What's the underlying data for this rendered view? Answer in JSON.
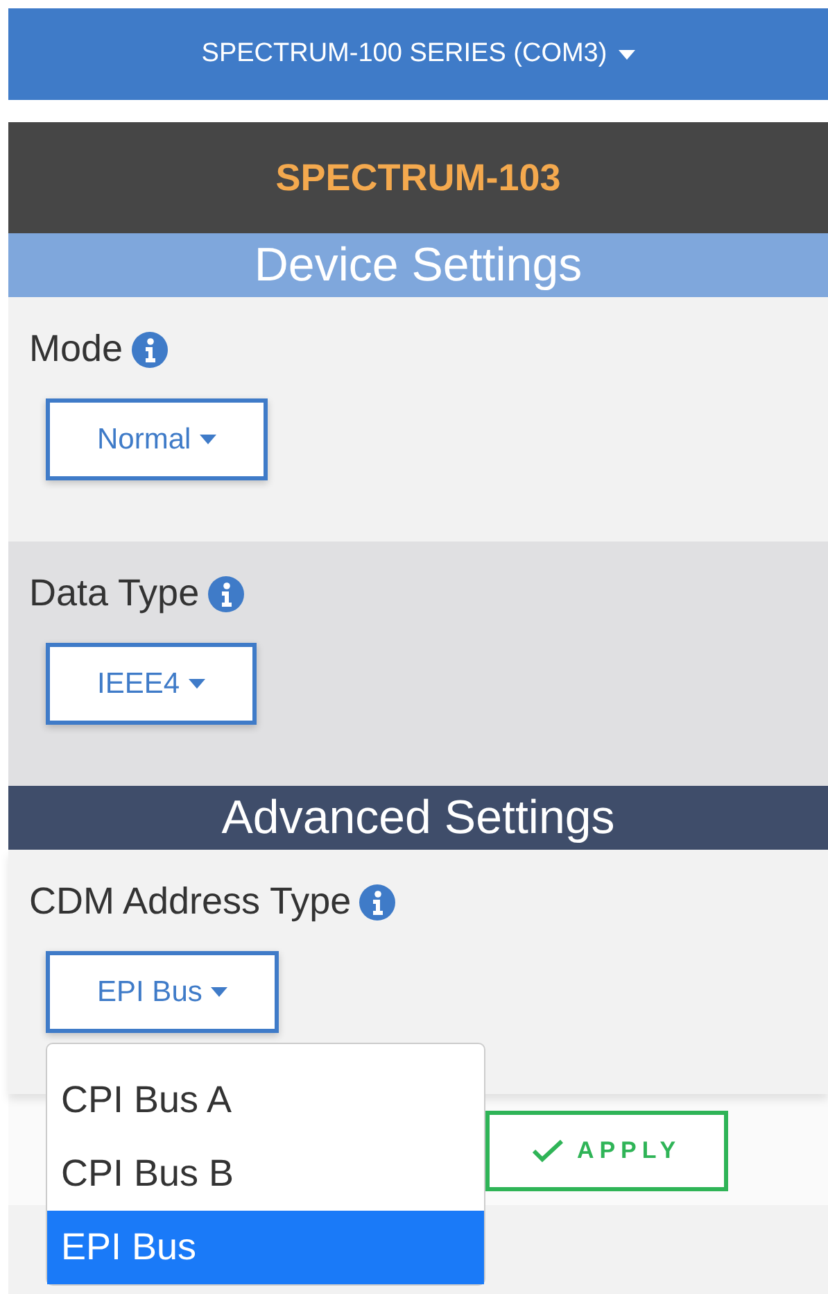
{
  "device_selector": {
    "label": "SPECTRUM-100 SERIES (COM3)"
  },
  "device_name": "SPECTRUM-103",
  "sections": [
    {
      "kind": "device",
      "title": "Device Settings",
      "fields": [
        {
          "label": "Mode",
          "value": "Normal",
          "expanded": false
        },
        {
          "label": "Data Type",
          "value": "IEEE4",
          "expanded": false
        }
      ]
    },
    {
      "kind": "advanced",
      "title": "Advanced Settings",
      "fields": [
        {
          "label": "CDM Address Type",
          "value": "EPI Bus",
          "expanded": true,
          "options": [
            {
              "label": "CPI Bus A",
              "selected": false
            },
            {
              "label": "CPI Bus B",
              "selected": false
            },
            {
              "label": "EPI Bus",
              "selected": true
            }
          ]
        }
      ]
    }
  ],
  "apply_button": {
    "label": "APPLY"
  }
}
